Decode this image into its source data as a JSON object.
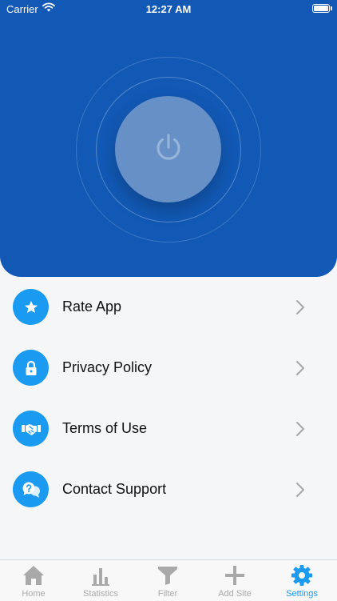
{
  "status_bar": {
    "carrier": "Carrier",
    "time": "12:27 AM"
  },
  "hero": {
    "power_icon": "power-icon"
  },
  "settings": [
    {
      "label": "Rate App",
      "icon": "star-icon"
    },
    {
      "label": "Privacy Policy",
      "icon": "lock-icon"
    },
    {
      "label": "Terms of Use",
      "icon": "handshake-icon"
    },
    {
      "label": "Contact Support",
      "icon": "chat-question-icon"
    }
  ],
  "tabs": [
    {
      "label": "Home",
      "icon": "home-icon"
    },
    {
      "label": "Statistics",
      "icon": "bar-chart-icon"
    },
    {
      "label": "Filter",
      "icon": "filter-icon"
    },
    {
      "label": "Add Site",
      "icon": "plus-icon"
    },
    {
      "label": "Settings",
      "icon": "gear-icon",
      "active": true
    }
  ],
  "colors": {
    "hero": "#1259b5",
    "accent": "#1a9af0",
    "background": "#f5f6f8"
  }
}
